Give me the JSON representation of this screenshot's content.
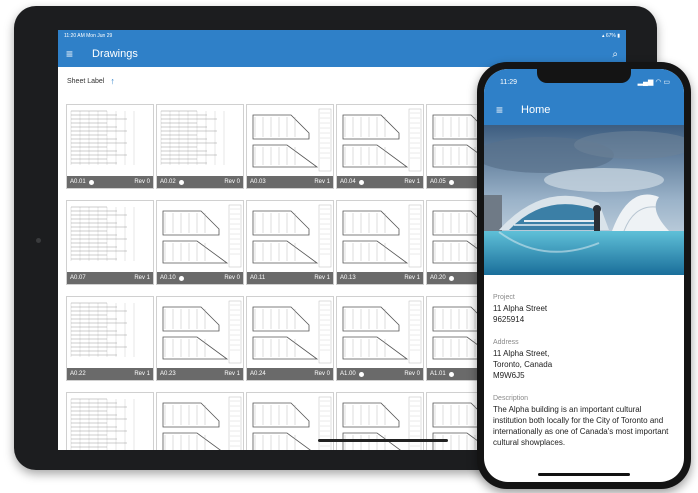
{
  "ipad": {
    "status": {
      "time": "11:20 AM  Mon Jun 29",
      "battery": "67%"
    },
    "appbar": {
      "title": "Drawings"
    },
    "sort": {
      "label": "Sheet Label",
      "arrow": "↑"
    },
    "tiles": [
      {
        "sheet": "A0.01",
        "rev": "Rev 0",
        "dot": true
      },
      {
        "sheet": "A0.02",
        "rev": "Rev 0",
        "dot": true
      },
      {
        "sheet": "A0.03",
        "rev": "Rev 1",
        "dot": false
      },
      {
        "sheet": "A0.04",
        "rev": "Rev 1",
        "dot": true
      },
      {
        "sheet": "A0.05",
        "rev": "",
        "dot": true
      },
      {
        "sheet": "A0.07",
        "rev": "Rev 1",
        "dot": false
      },
      {
        "sheet": "A0.10",
        "rev": "Rev 0",
        "dot": true
      },
      {
        "sheet": "A0.11",
        "rev": "Rev 1",
        "dot": false
      },
      {
        "sheet": "A0.13",
        "rev": "Rev 1",
        "dot": false
      },
      {
        "sheet": "A0.20",
        "rev": "",
        "dot": true
      },
      {
        "sheet": "A0.22",
        "rev": "Rev 1",
        "dot": false
      },
      {
        "sheet": "A0.23",
        "rev": "Rev 1",
        "dot": false
      },
      {
        "sheet": "A0.24",
        "rev": "Rev 0",
        "dot": false
      },
      {
        "sheet": "A1.00",
        "rev": "Rev 0",
        "dot": true
      },
      {
        "sheet": "A1.01",
        "rev": "",
        "dot": true
      },
      {
        "sheet": "",
        "rev": "",
        "dot": false
      },
      {
        "sheet": "",
        "rev": "",
        "dot": false
      },
      {
        "sheet": "",
        "rev": "",
        "dot": false
      },
      {
        "sheet": "",
        "rev": "",
        "dot": false
      },
      {
        "sheet": "",
        "rev": "",
        "dot": false
      }
    ]
  },
  "iphone": {
    "status": {
      "time": "11:29"
    },
    "appbar": {
      "title": "Home"
    },
    "project": {
      "label": "Project",
      "name": "11 Alpha Street",
      "number": "9625914"
    },
    "address": {
      "label": "Address",
      "line1": "11 Alpha Street,",
      "line2": "Toronto, Canada",
      "line3": "M9W6J5"
    },
    "description": {
      "label": "Description",
      "text": "The Alpha building is an important cultural institution both locally for the City of Toronto and internationally as one of Canada's most important cultural showplaces."
    }
  },
  "colors": {
    "primary": "#2f80c8",
    "device": "#1c1d1f"
  }
}
